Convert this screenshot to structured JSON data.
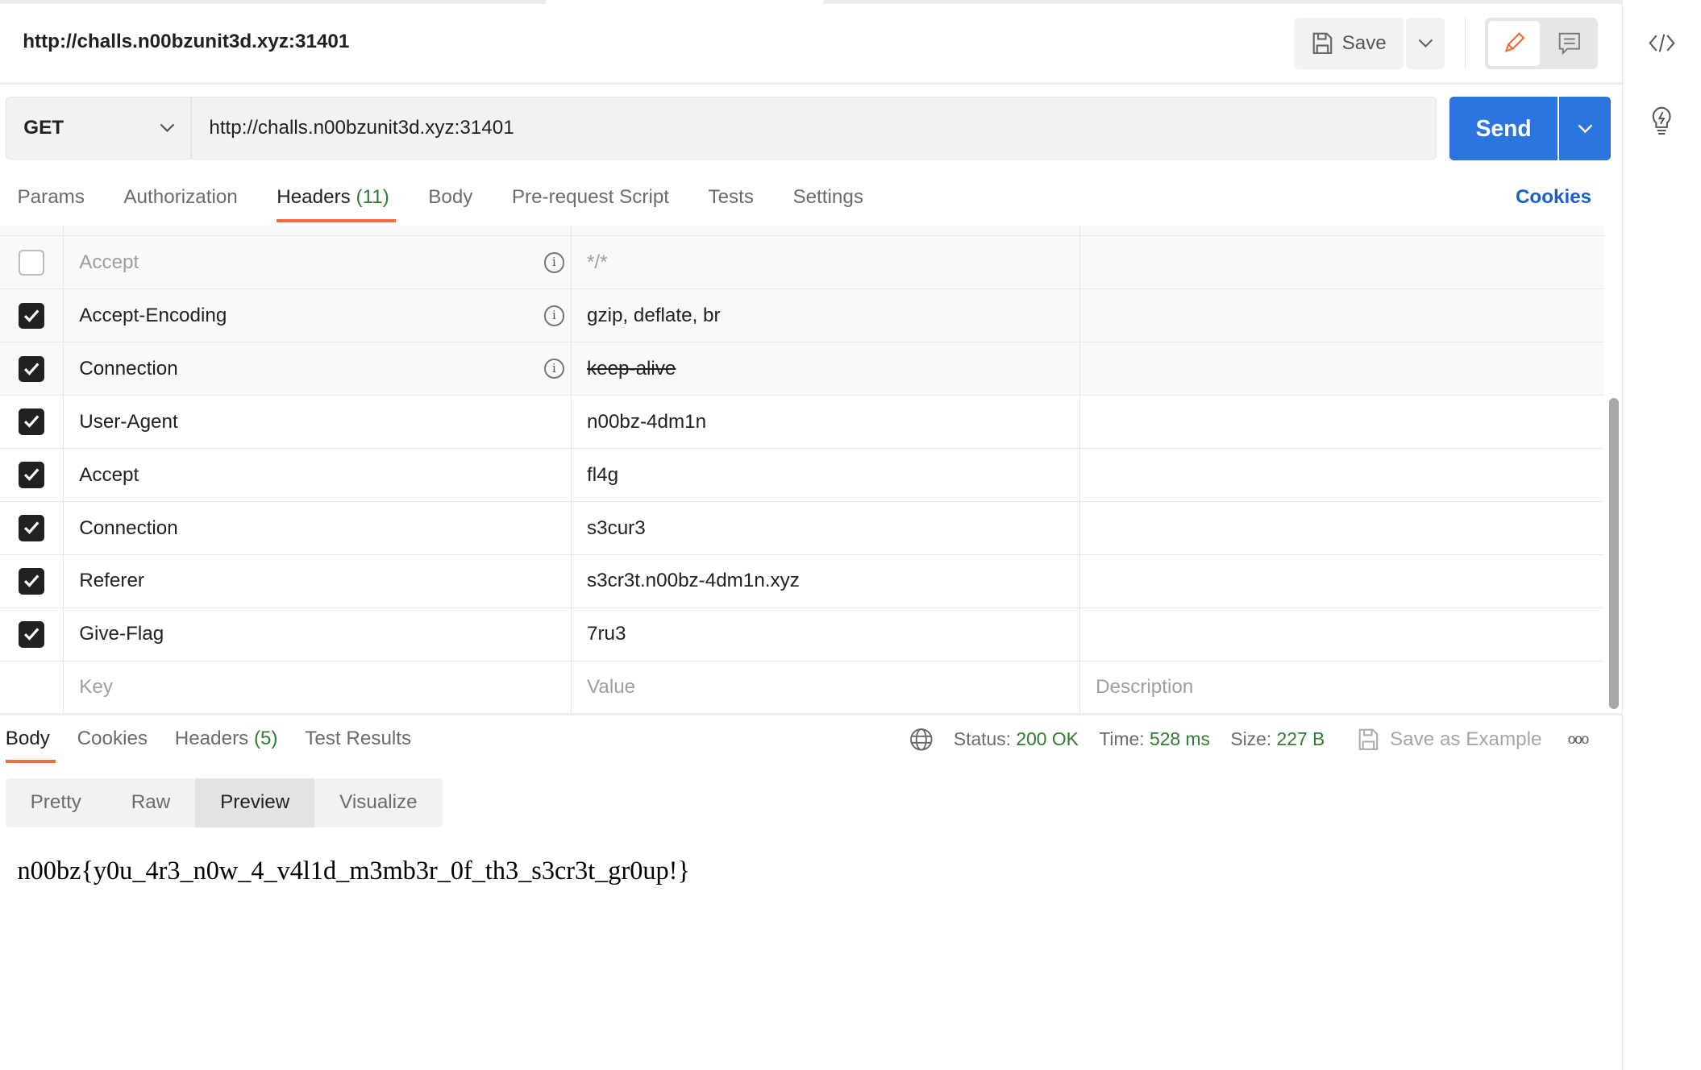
{
  "header": {
    "title": "http://challs.n00bzunit3d.xyz:31401",
    "save_label": "Save"
  },
  "request": {
    "method": "GET",
    "url": "http://challs.n00bzunit3d.xyz:31401",
    "send_label": "Send"
  },
  "req_tabs": [
    {
      "label": "Params"
    },
    {
      "label": "Authorization"
    },
    {
      "label": "Headers",
      "count": "(11)"
    },
    {
      "label": "Body"
    },
    {
      "label": "Pre-request Script"
    },
    {
      "label": "Tests"
    },
    {
      "label": "Settings"
    }
  ],
  "cookies_link": "Cookies",
  "headers": [
    {
      "key": "Accept",
      "value": "*/*",
      "checked": false,
      "auto": true,
      "info": true
    },
    {
      "key": "Accept-Encoding",
      "value": "gzip, deflate, br",
      "checked": true,
      "auto": true,
      "info": true
    },
    {
      "key": "Connection",
      "value": "keep-alive",
      "checked": true,
      "auto": true,
      "info": true,
      "overridden": true
    },
    {
      "key": "User-Agent",
      "value": "n00bz-4dm1n",
      "checked": true
    },
    {
      "key": "Accept",
      "value": "fl4g",
      "checked": true
    },
    {
      "key": "Connection",
      "value": "s3cur3",
      "checked": true
    },
    {
      "key": "Referer",
      "value": "s3cr3t.n00bz-4dm1n.xyz",
      "checked": true
    },
    {
      "key": "Give-Flag",
      "value": "7ru3",
      "checked": true
    }
  ],
  "new_row": {
    "key": "Key",
    "value": "Value",
    "description": "Description"
  },
  "res_tabs": [
    {
      "label": "Body"
    },
    {
      "label": "Cookies"
    },
    {
      "label": "Headers",
      "count": "(5)"
    },
    {
      "label": "Test Results"
    }
  ],
  "response": {
    "status_label": "Status:",
    "status": "200 OK",
    "time_label": "Time:",
    "time": "528 ms",
    "size_label": "Size:",
    "size": "227 B",
    "save_example": "Save as Example"
  },
  "views": [
    "Pretty",
    "Raw",
    "Preview",
    "Visualize"
  ],
  "selected_view": "Preview",
  "body": "n00bz{y0u_4r3_n0w_4_v4l1d_m3mb3r_0f_th3_s3cr3t_gr0up!}",
  "colors": {
    "accent": "#f26b3a",
    "send": "#2c74e0",
    "success": "#2e7d32",
    "link": "#1a5fd1"
  }
}
